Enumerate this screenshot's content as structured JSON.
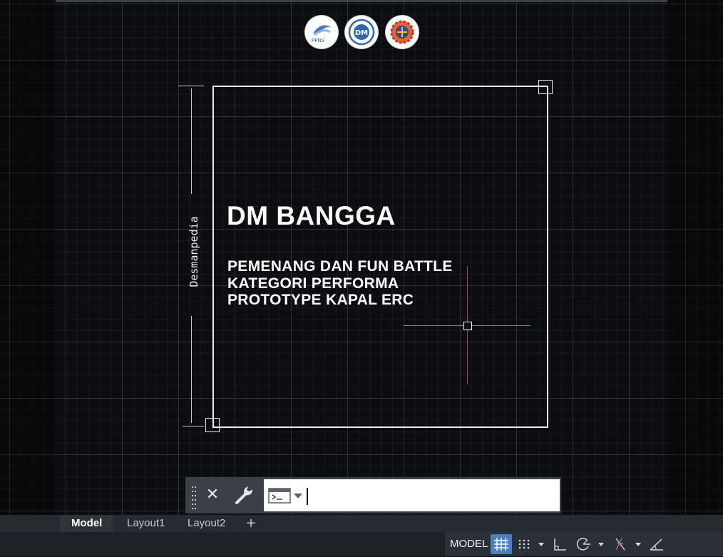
{
  "logos": [
    {
      "name": "ppns-logo",
      "text": "PPNS"
    },
    {
      "name": "dm-logo",
      "text": "DM"
    },
    {
      "name": "gear-logo",
      "text": ""
    }
  ],
  "drawing": {
    "dimension_text": "Desmanpedia",
    "title": "DM BANGGA",
    "subtitle_lines": [
      "PEMENANG DAN FUN BATTLE",
      "KATEGORI PERFORMA",
      "PROTOTYPE KAPAL ERC"
    ]
  },
  "command_line": {
    "close_icon": "close-icon",
    "settings_icon": "wrench-icon",
    "prompt_icon": "command-prompt-icon",
    "value": "",
    "placeholder": ""
  },
  "tabs": [
    {
      "label": "Model",
      "active": true
    },
    {
      "label": "Layout1",
      "active": false
    },
    {
      "label": "Layout2",
      "active": false
    }
  ],
  "tab_add_label": "+",
  "status": {
    "model_label": "MODEL",
    "buttons": [
      "grid-icon",
      "snap-icon",
      "dropdown-icon",
      "ortho-icon",
      "polar-icon",
      "dropdown-icon",
      "osnap-icon",
      "dropdown-icon",
      "angle-icon"
    ]
  },
  "colors": {
    "canvas_bg": "#0c0d10",
    "grid_button_active": "#4a7fc0",
    "crosshair_x": "#4e9a5e",
    "crosshair_y": "#a8424c"
  }
}
